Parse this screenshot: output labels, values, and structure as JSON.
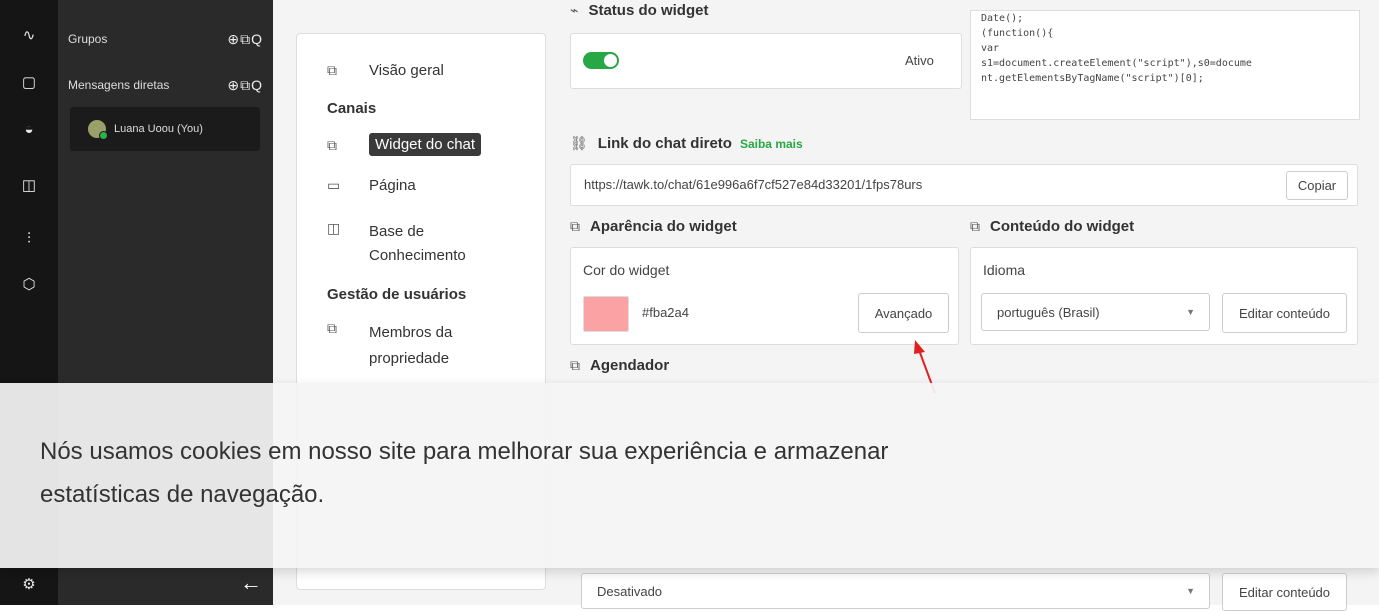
{
  "sidebar": {
    "icons": [
      "activity-icon",
      "chat-icon",
      "inbox-icon",
      "book-icon",
      "bar-chart-icon",
      "cube-icon",
      "settings-icon"
    ]
  },
  "chat_list": {
    "groups_label": "Grupos",
    "dm_label": "Mensagens diretas",
    "actions": "⊕⧉Q",
    "user": "Luana Uoou (You)"
  },
  "nav": {
    "overview": "Visão geral",
    "channels_heading": "Canais",
    "chat_widget": "Widget do chat",
    "page": "Página",
    "kb_line1": "Base de",
    "kb_line2": "Conhecimento",
    "user_mgmt_heading": "Gestão de usuários",
    "members_line1": "Membros da",
    "members_line2": "propriedade"
  },
  "widget_status": {
    "title": "Status do widget",
    "state": "Ativo"
  },
  "code_snippet": [
    "Date();",
    "(function(){",
    "var",
    "s1=document.createElement(\"script\"),s0=docume",
    "nt.getElementsByTagName(\"script\")[0];"
  ],
  "direct_link": {
    "title": "Link do chat direto",
    "more": "Saiba mais",
    "url": "https://tawk.to/chat/61e996a6f7cf527e84d33201/1fps78urs",
    "copy": "Copiar"
  },
  "appearance": {
    "title": "Aparência do widget",
    "color_label": "Cor do widget",
    "color_value": "#fba2a4",
    "advanced": "Avançado"
  },
  "content": {
    "title": "Conteúdo do widget",
    "language_label": "Idioma",
    "language_value": "português (Brasil)",
    "edit": "Editar conteúdo"
  },
  "scheduler": {
    "title": "Agendador",
    "state": "Desativado",
    "edit": "Editar conteúdo"
  },
  "cookie_banner": {
    "text": "Nós usamos cookies em nosso site para melhorar sua experiência e armazenar estatísticas de navegação."
  }
}
